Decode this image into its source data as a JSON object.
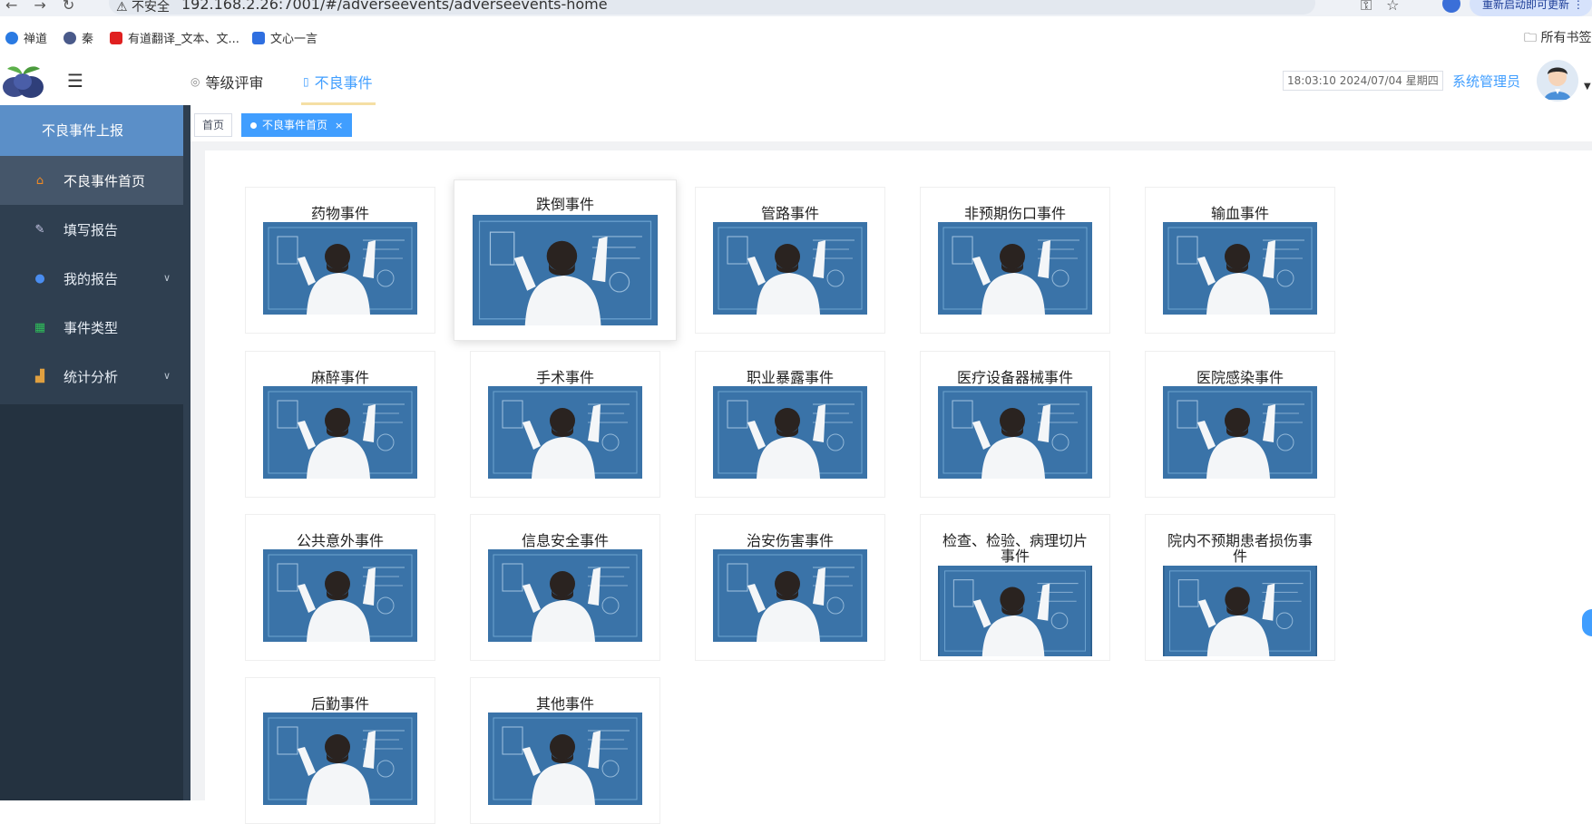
{
  "browser": {
    "warning": "⚠ 不安全",
    "url": "192.168.2.26:7001/#/adverseevents/adverseevents-home",
    "update_button": "重新启动即可更新 ⋮",
    "bookmarks": [
      "禅道",
      "秦",
      "有道翻译_文本、文...",
      "文心一言"
    ],
    "bookmarks_folder": "所有书签"
  },
  "header": {
    "top_tabs": [
      "等级评审",
      "不良事件"
    ],
    "active_tab": "不良事件",
    "clock": "18:03:10 2024/07/04 星期四",
    "user": "系统管理员"
  },
  "sidebar": {
    "title": "不良事件上报",
    "items": [
      {
        "label": "不良事件首页",
        "icon": "home-icon"
      },
      {
        "label": "填写报告",
        "icon": "edit-icon"
      },
      {
        "label": "我的报告",
        "icon": "user-icon"
      },
      {
        "label": "事件类型",
        "icon": "grid-icon"
      },
      {
        "label": "统计分析",
        "icon": "chart-icon"
      }
    ]
  },
  "tabs": {
    "home": "首页",
    "active": "不良事件首页",
    "close": "×"
  },
  "cards": [
    {
      "title": "药物事件"
    },
    {
      "title": "跌倒事件"
    },
    {
      "title": "管路事件"
    },
    {
      "title": "非预期伤口事件"
    },
    {
      "title": "输血事件"
    },
    {
      "title": "麻醉事件"
    },
    {
      "title": "手术事件"
    },
    {
      "title": "职业暴露事件"
    },
    {
      "title": "医疗设备器械事件"
    },
    {
      "title": "医院感染事件"
    },
    {
      "title": "公共意外事件"
    },
    {
      "title": "信息安全事件"
    },
    {
      "title": "治安伤害事件"
    },
    {
      "title": "检查、检验、病理切片事件"
    },
    {
      "title": "院内不预期患者损伤事件"
    },
    {
      "title": "后勤事件"
    },
    {
      "title": "其他事件"
    }
  ]
}
